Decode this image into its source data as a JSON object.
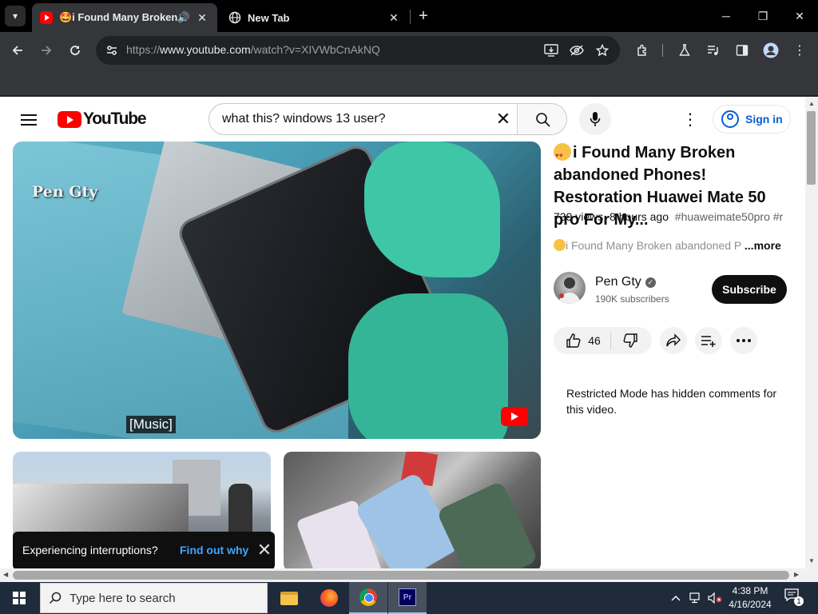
{
  "browser": {
    "tabs": [
      {
        "title": "🤩i Found Many Broken ab",
        "active": true,
        "audio": true
      },
      {
        "title": "New Tab",
        "active": false
      }
    ],
    "url_prefix": "https://",
    "url_host": "www.youtube.com",
    "url_path": "/watch?v=XIVWbCnAkNQ"
  },
  "youtube": {
    "logo_text": "YouTube",
    "search_query": "what this? windows 13 user?",
    "sign_in_label": "Sign in",
    "player": {
      "watermark": "Pen Gty",
      "caption": "[Music]"
    },
    "video": {
      "title": "i Found Many Broken abandoned Phones! Restoration Huawei Mate 50 pro For My...",
      "views": "739 views",
      "age": "8 hours ago",
      "hashtags": "#huaweimate50pro #r",
      "description_preview": "i Found Many Broken abandoned P",
      "more_label": "...more",
      "channel_name": "Pen Gty",
      "subscribers": "190K subscribers",
      "subscribe_label": "Subscribe",
      "likes": "46",
      "restricted_notice": "Restricted Mode has hidden comments for this video."
    },
    "toast": {
      "message": "Experiencing interruptions?",
      "link": "Find out why"
    }
  },
  "taskbar": {
    "search_placeholder": "Type here to search",
    "time": "4:38 PM",
    "date": "4/16/2024",
    "notification_count": "1",
    "pinned_apps": [
      "file-explorer",
      "firefox",
      "chrome",
      "premiere-pro"
    ]
  },
  "icons": {
    "premiere_label": "Pr"
  }
}
